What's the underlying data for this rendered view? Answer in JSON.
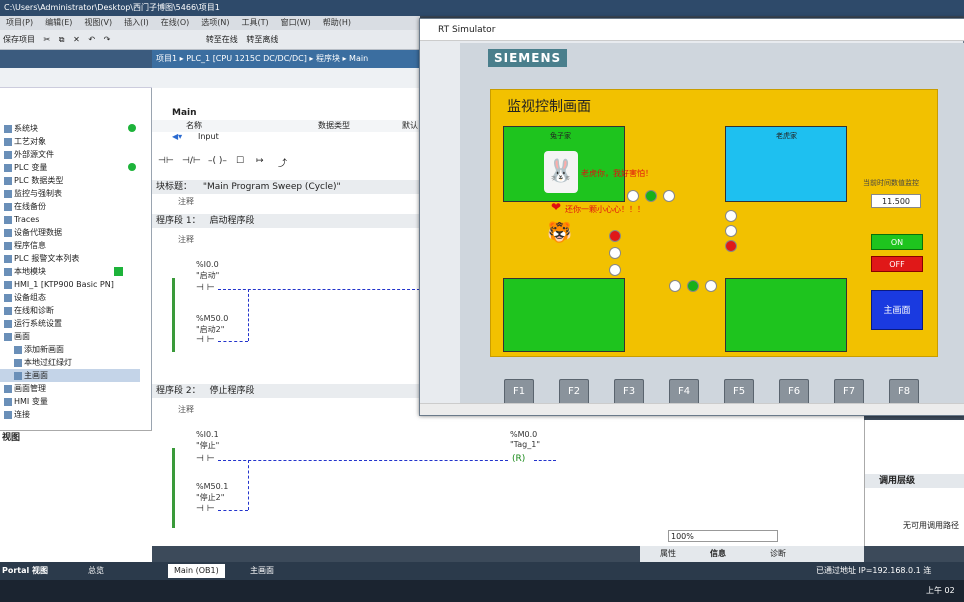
{
  "window": {
    "title": "C:\\Users\\Administrator\\Desktop\\西门子博图\\5466\\项目1"
  },
  "menu": [
    "项目(P)",
    "编辑(E)",
    "视图(V)",
    "插入(I)",
    "在线(O)",
    "选项(N)",
    "工具(T)",
    "窗口(W)",
    "帮助(H)"
  ],
  "toolbar": {
    "save_label": "保存项目",
    "go_online": "转至在线",
    "go_offline": "转至离线"
  },
  "breadcrumb": "项目1 ▸ PLC_1 [CPU 1215C DC/DC/DC] ▸ 程序块 ▸ Main",
  "tree": [
    {
      "label": "系统块",
      "status": "green"
    },
    {
      "label": "工艺对象"
    },
    {
      "label": "外部源文件"
    },
    {
      "label": "PLC 变量",
      "status": "green"
    },
    {
      "label": "PLC 数据类型"
    },
    {
      "label": "监控与强制表"
    },
    {
      "label": "在线备份"
    },
    {
      "label": "Traces"
    },
    {
      "label": "设备代理数据"
    },
    {
      "label": "程序信息"
    },
    {
      "label": "PLC 报警文本列表"
    },
    {
      "label": "本地模块",
      "status": "check"
    },
    {
      "label": "HMI_1 [KTP900 Basic PN]"
    },
    {
      "label": "设备组态"
    },
    {
      "label": "在线和诊断"
    },
    {
      "label": "运行系统设置"
    },
    {
      "label": "画面"
    },
    {
      "label": "添加新画面"
    },
    {
      "label": "本地过红绿灯"
    },
    {
      "label": "主画面",
      "selected": true
    },
    {
      "label": "画面管理"
    },
    {
      "label": "HMI 变量"
    },
    {
      "label": "连接"
    }
  ],
  "overview_title": "视图",
  "editor": {
    "block_name": "Main",
    "columns": [
      "名称",
      "数据类型",
      "默认"
    ],
    "input_row": "Input",
    "block_title_label": "块标题：",
    "block_title": "\"Main Program Sweep (Cycle)\"",
    "comment": "注释",
    "networks": [
      {
        "label": "程序段 1：",
        "title": "启动程序段",
        "comment": "注释",
        "contacts": [
          {
            "addr": "%I0.0",
            "name": "\"启动\""
          },
          {
            "addr": "%M50.0",
            "name": "\"启动2\""
          }
        ]
      },
      {
        "label": "程序段 2：",
        "title": "停止程序段",
        "comment": "注释",
        "contacts": [
          {
            "addr": "%I0.1",
            "name": "\"停止\""
          },
          {
            "addr": "%M50.1",
            "name": "\"停止2\""
          }
        ],
        "coil": {
          "addr": "%M0.0",
          "name": "\"Tag_1\"",
          "symbol": "R"
        }
      }
    ],
    "zoom": "100%"
  },
  "right_panel": {
    "title": "调用层级",
    "body": "无可用调用路径"
  },
  "info_tabs": [
    "属性",
    "信息",
    "诊断"
  ],
  "tia_tasks": [
    {
      "label": "Portal 视图"
    },
    {
      "label": "总览"
    },
    {
      "label": "Main (OB1)"
    },
    {
      "label": "主画面"
    }
  ],
  "status_text": "已通过地址 IP=192.168.0.1 连",
  "rt": {
    "title": "RT Simulator",
    "brand": "SIEMENS",
    "screen_title": "监视控制画面",
    "rabbit_label": "兔子家",
    "tiger_label": "老虎家",
    "msg1": "老虎你，我好害怕！",
    "msg2": "还你一颗小心心！！！",
    "time_label": "当前时间数值监控",
    "time_value": "11.500",
    "btn_on": "ON",
    "btn_off": "OFF",
    "btn_main": "主画面",
    "fkeys": [
      "F1",
      "F2",
      "F3",
      "F4",
      "F5",
      "F6",
      "F7",
      "F8"
    ]
  },
  "colors": {
    "hmi_bg": "#f2c100",
    "green_house": "#1ec41e",
    "blue_house": "#1ec0f0",
    "tia_blue": "#3b6ea0"
  },
  "clock": "上午 02"
}
